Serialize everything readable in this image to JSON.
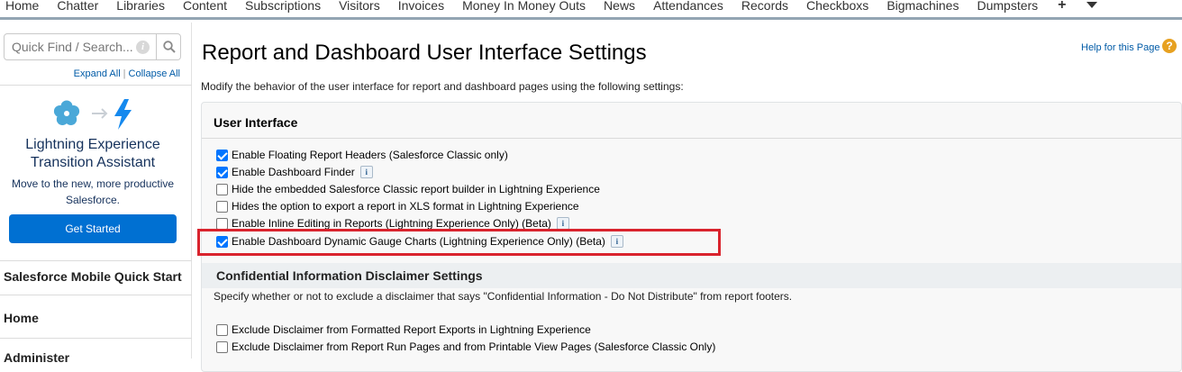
{
  "topnav": {
    "tabs": [
      "Home",
      "Chatter",
      "Libraries",
      "Content",
      "Subscriptions",
      "Visitors",
      "Invoices",
      "Money In Money Outs",
      "News",
      "Attendances",
      "Records",
      "Checkboxs",
      "Bigmachines",
      "Dumpsters"
    ],
    "plus_icon": "plus-icon",
    "more_icon": "caret-down-icon"
  },
  "sidebar": {
    "search_placeholder": "Quick Find / Search...",
    "expand_all": "Expand All",
    "separator": "|",
    "collapse_all": "Collapse All",
    "lea": {
      "title_line1": "Lightning Experience",
      "title_line2": "Transition Assistant",
      "desc_line1": "Move to the new, more productive",
      "desc_line2": "Salesforce.",
      "button": "Get Started"
    },
    "sections": [
      "Salesforce Mobile Quick Start",
      "Home",
      "Administer"
    ]
  },
  "main": {
    "title": "Report and Dashboard User Interface Settings",
    "help_link": "Help for this Page",
    "help_icon": "?",
    "description": "Modify the behavior of the user interface for report and dashboard pages using the following settings:",
    "ui_section": {
      "title": "User Interface",
      "options": [
        {
          "label": "Enable Floating Report Headers (Salesforce Classic only)",
          "checked": true,
          "info": false
        },
        {
          "label": "Enable Dashboard Finder",
          "checked": true,
          "info": true
        },
        {
          "label": "Hide the embedded Salesforce Classic report builder in Lightning Experience",
          "checked": false,
          "info": false
        },
        {
          "label": "Hides the option to export a report in XLS format in Lightning Experience",
          "checked": false,
          "info": false
        },
        {
          "label": "Enable Inline Editing in Reports (Lightning Experience Only) (Beta)",
          "checked": false,
          "info": true
        },
        {
          "label": "Enable Dashboard Dynamic Gauge Charts (Lightning Experience Only) (Beta)",
          "checked": true,
          "info": true
        }
      ]
    },
    "info_glyph": "i",
    "disclaimer_section": {
      "title": "Confidential Information Disclaimer Settings",
      "description": "Specify whether or not to exclude a disclaimer that says \"Confidential Information - Do Not Distribute\" from report footers.",
      "options": [
        {
          "label": "Exclude Disclaimer from Formatted Report Exports in Lightning Experience",
          "checked": false
        },
        {
          "label": "Exclude Disclaimer from Report Run Pages and from Printable View Pages (Salesforce Classic Only)",
          "checked": false
        }
      ]
    },
    "highlight_color": "#d9232d",
    "accent_color": "#0070d2"
  }
}
